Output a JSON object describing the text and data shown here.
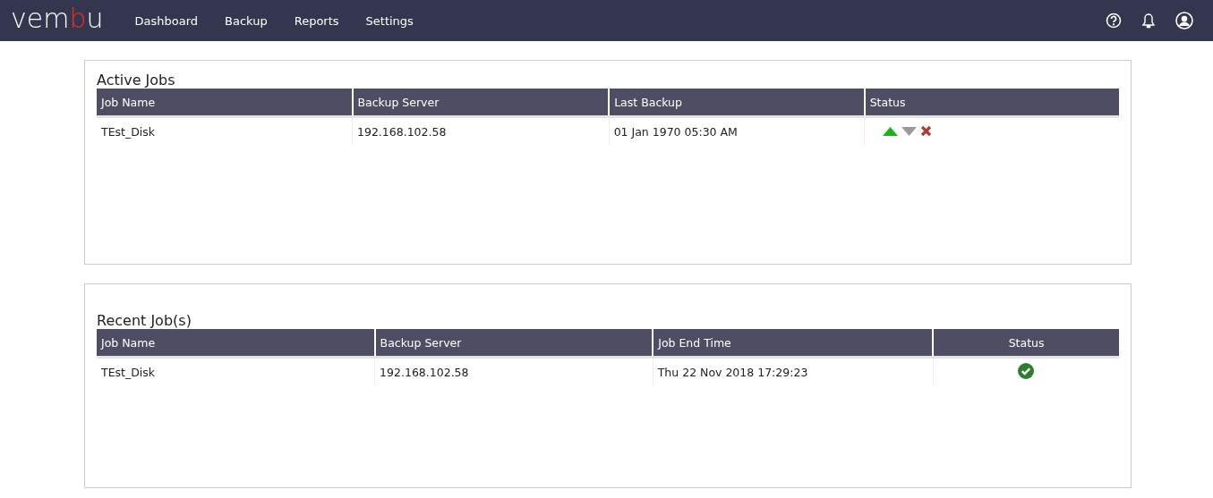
{
  "logo": [
    {
      "text": "vem",
      "accent": false
    },
    {
      "text": "b",
      "accent": true
    },
    {
      "text": "u",
      "accent": false
    }
  ],
  "nav": [
    "Dashboard",
    "Backup",
    "Reports",
    "Settings"
  ],
  "header_icons": [
    {
      "kind": "help"
    },
    {
      "kind": "notifications"
    },
    {
      "kind": "account"
    }
  ],
  "panels": [
    {
      "title": "Active Jobs",
      "columns": [
        {
          "label": "Job Name",
          "centered": false
        },
        {
          "label": "Backup Server",
          "centered": false
        },
        {
          "label": "Last Backup",
          "centered": false
        },
        {
          "label": "Status",
          "centered": false
        }
      ],
      "rows": [
        {
          "cells": [
            "TEst_Disk",
            "192.168.102.58",
            "01 Jan 1970 05:30 AM"
          ],
          "status": [
            {
              "kind": "up"
            },
            {
              "kind": "down"
            },
            {
              "kind": "cancel"
            }
          ]
        }
      ]
    },
    {
      "title": "Recent Job(s)",
      "columns": [
        {
          "label": "Job Name",
          "centered": false
        },
        {
          "label": "Backup Server",
          "centered": false
        },
        {
          "label": "Job End Time",
          "centered": false
        },
        {
          "label": "Status",
          "centered": true
        }
      ],
      "rows": [
        {
          "cells": [
            "TEst_Disk",
            "192.168.102.58",
            "Thu 22 Nov 2018 17:29:23"
          ],
          "status": [
            {
              "kind": "success"
            }
          ]
        }
      ]
    }
  ]
}
